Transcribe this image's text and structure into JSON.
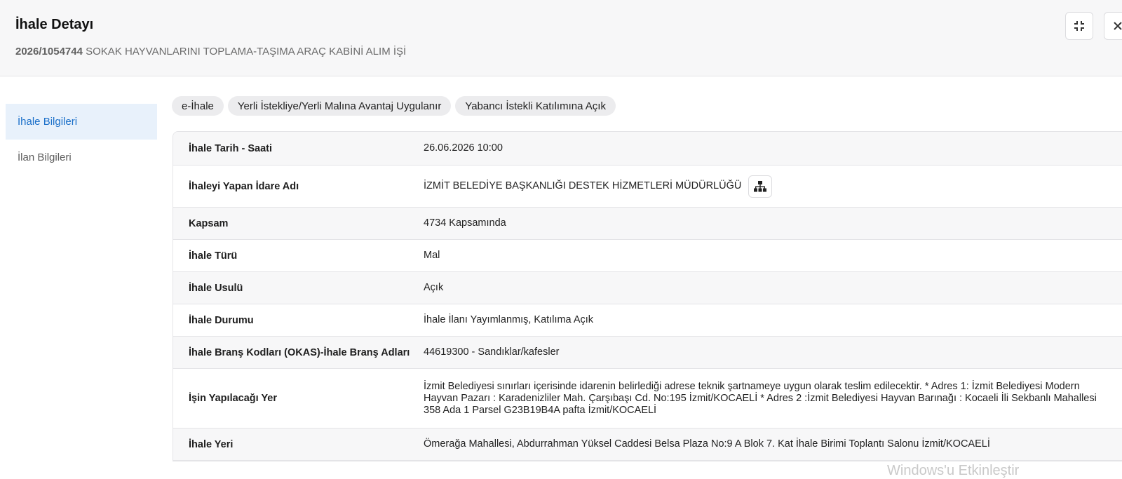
{
  "header": {
    "title": "İhale Detayı",
    "ikn": "2026/1054744",
    "name": "SOKAK HAYVANLARINI TOPLAMA-TAŞIMA ARAÇ KABİNİ ALIM İŞİ"
  },
  "actions": {
    "shrink_icon": "compress-icon",
    "close_icon": "close-icon"
  },
  "sidebar": {
    "items": [
      {
        "label": "İhale Bilgileri",
        "active": true
      },
      {
        "label": "İlan Bilgileri",
        "active": false
      }
    ]
  },
  "tags": [
    "e-İhale",
    "Yerli İstekliye/Yerli Malına Avantaj Uygulanır",
    "Yabancı İstekli Katılımına Açık"
  ],
  "details": [
    {
      "label": "İhale Tarih - Saati",
      "value": "26.06.2026 10:00"
    },
    {
      "label": "İhaleyi Yapan İdare Adı",
      "value": "İZMİT BELEDİYE BAŞKANLIĞI DESTEK HİZMETLERİ MÜDÜRLÜĞÜ"
    },
    {
      "label": "Kapsam",
      "value": "4734 Kapsamında"
    },
    {
      "label": "İhale Türü",
      "value": "Mal"
    },
    {
      "label": "İhale Usulü",
      "value": "Açık"
    },
    {
      "label": "İhale Durumu",
      "value": "İhale İlanı Yayımlanmış, Katılıma Açık"
    },
    {
      "label": "İhale Branş Kodları (OKAS)-İhale Branş Adları",
      "value": "44619300 - Sandıklar/kafesler"
    },
    {
      "label": "İşin Yapılacağı Yer",
      "value": "İzmit Belediyesi sınırları içerisinde idarenin belirlediği adrese teknik şartnameye uygun olarak teslim edilecektir. * Adres 1: İzmit Belediyesi Modern Hayvan Pazarı : Karadenizliler Mah. Çarşıbaşı Cd. No:195 İzmit/KOCAELİ * Adres 2 :İzmit Belediyesi Hayvan Barınağı : Kocaeli İli Sekbanlı Mahallesi 358 Ada 1 Parsel G23B19B4A pafta İzmit/KOCAELİ"
    },
    {
      "label": "İhale Yeri",
      "value": "Ömerağa Mahallesi, Abdurrahman Yüksel Caddesi Belsa Plaza No:9 A Blok 7. Kat İhale Birimi Toplantı Salonu İzmit/KOCAELİ"
    }
  ],
  "watermark": "Windows'u Etkinleştir"
}
